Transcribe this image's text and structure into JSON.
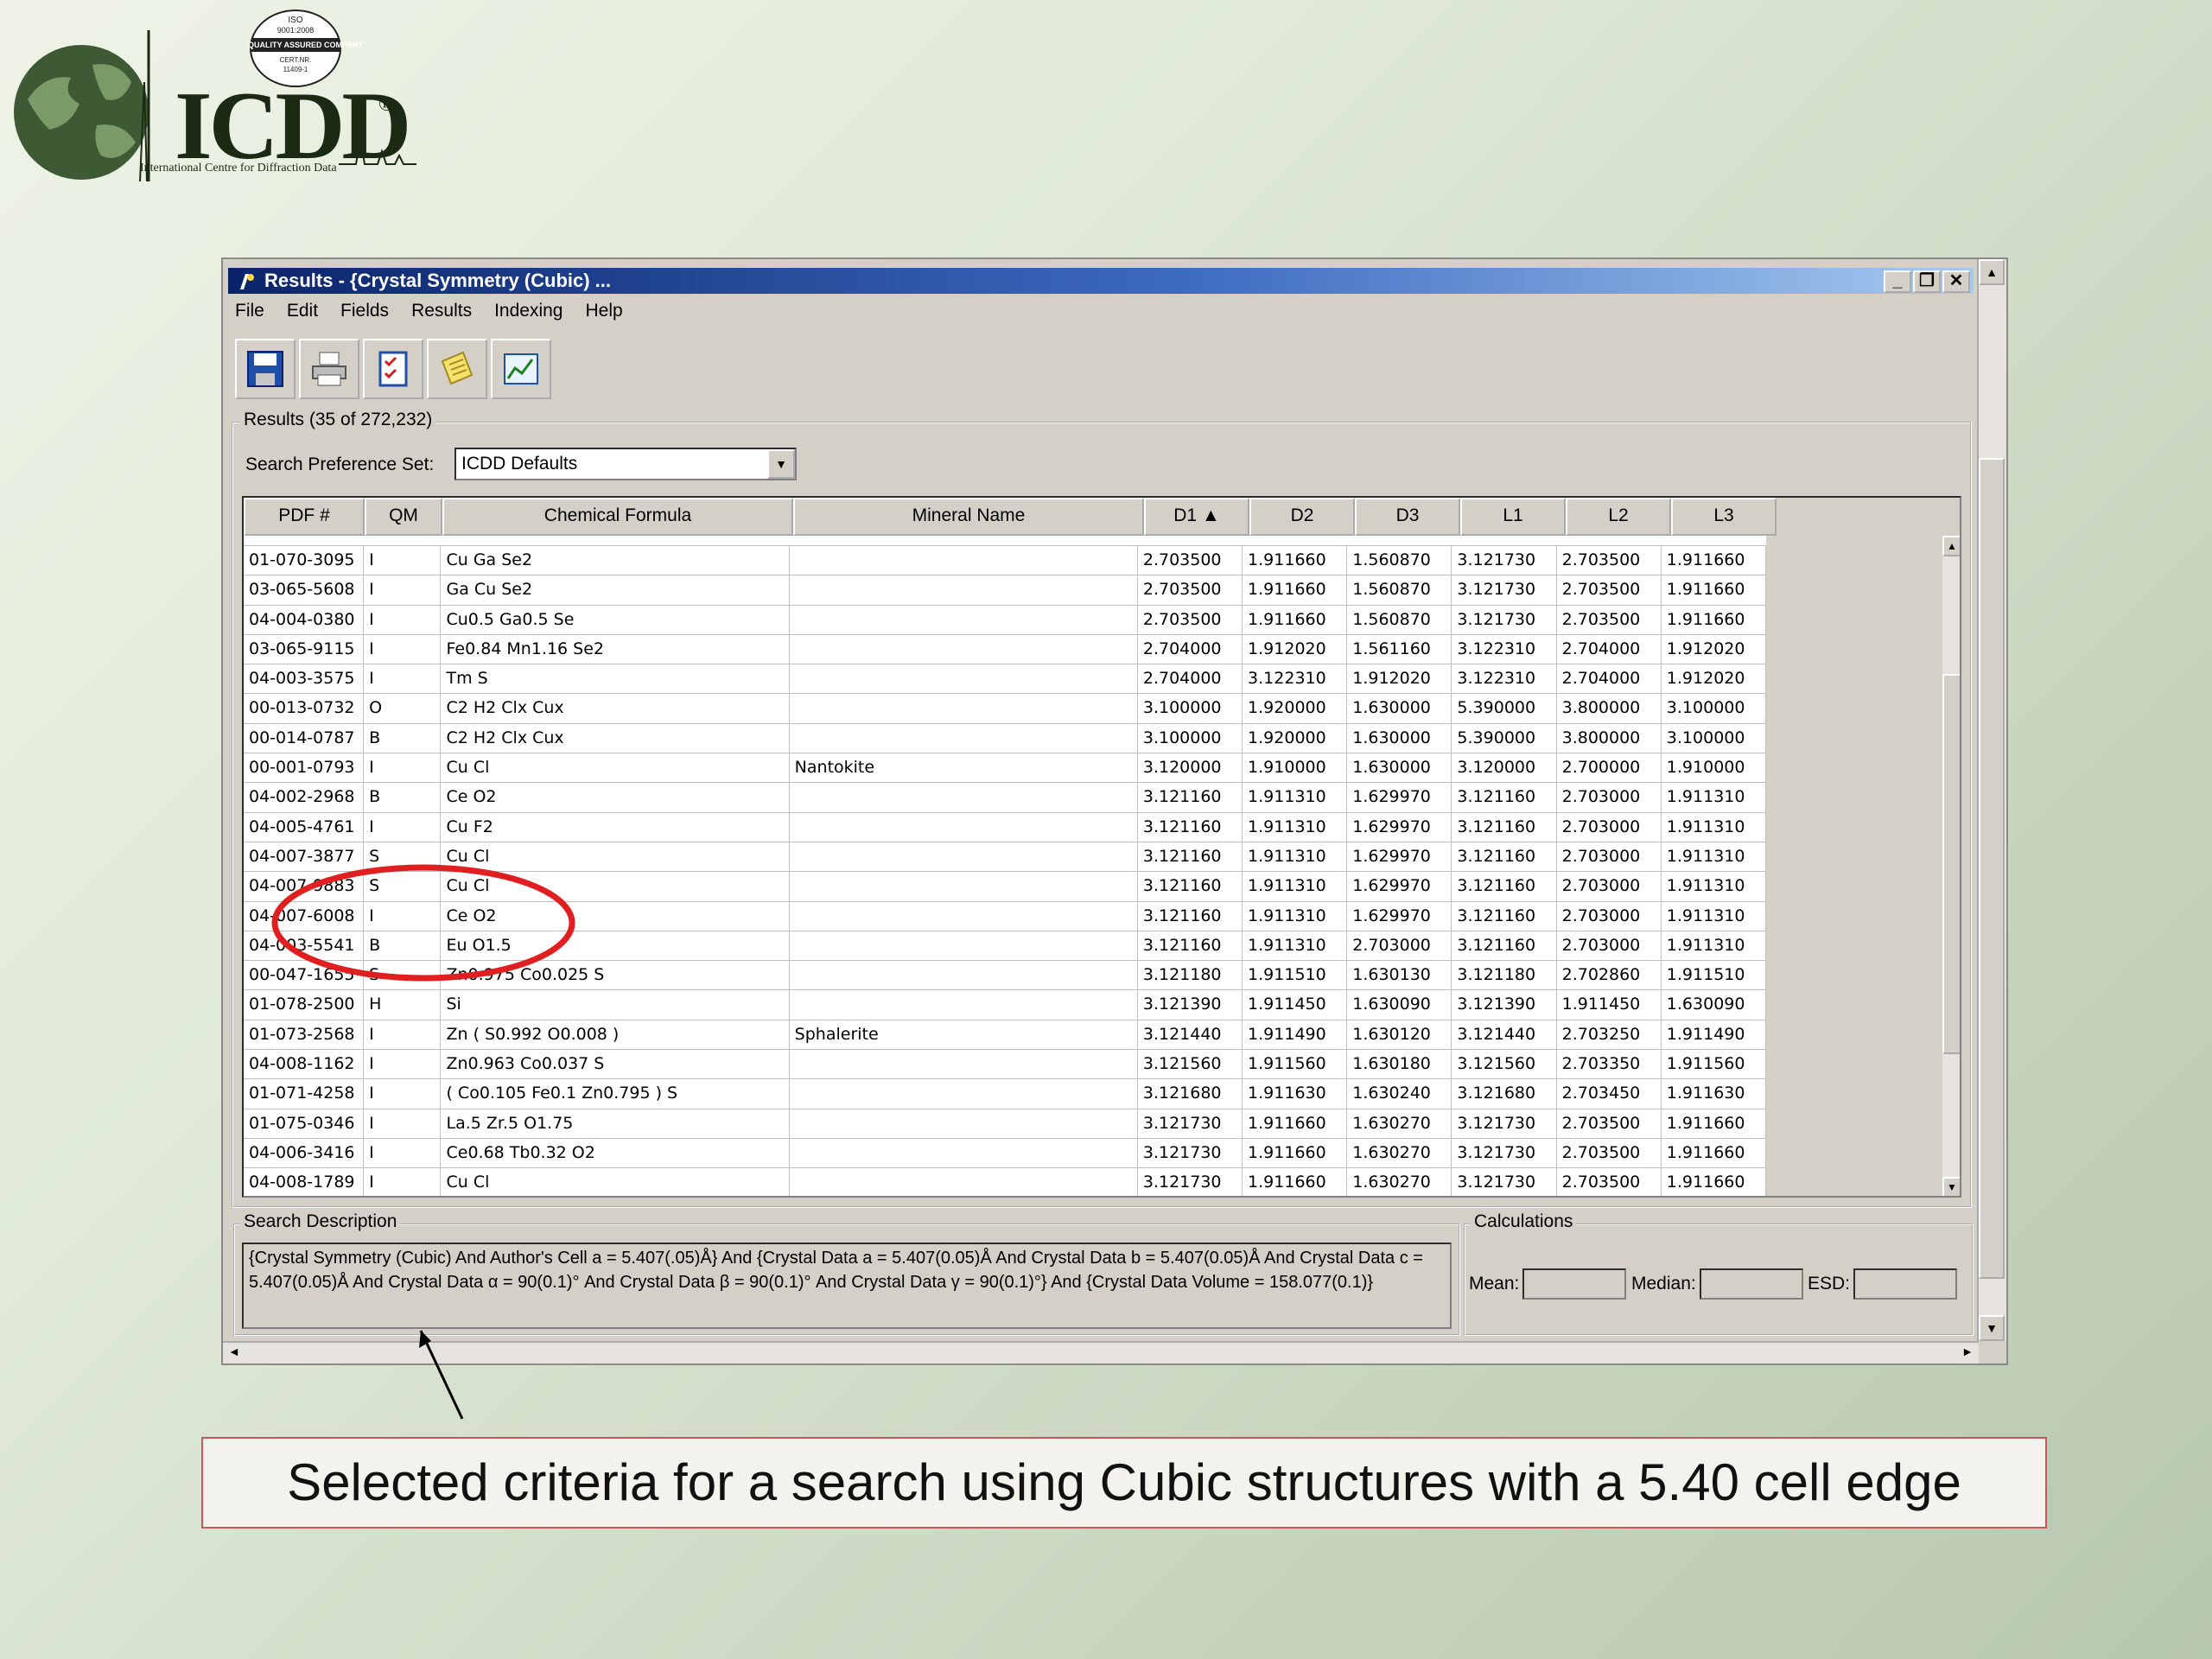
{
  "logo": {
    "text": "ICDD",
    "registered": "®",
    "subtitle": "International Centre for Diffraction Data",
    "iso_badge": [
      "ISO",
      "9001:2008",
      "QUALITY ASSURED COMPANY",
      "CERT.NR.",
      "11409-1"
    ]
  },
  "window": {
    "title": "Results - {Crystal Symmetry (Cubic) ...",
    "controls": [
      "_",
      "❐",
      "✕"
    ]
  },
  "menu": [
    "File",
    "Edit",
    "Fields",
    "Results",
    "Indexing",
    "Help"
  ],
  "toolbar": [
    "save-icon",
    "print-icon",
    "checklist-icon",
    "note-icon",
    "chart-icon"
  ],
  "results_group_label": "Results (35 of 272,232)",
  "search_pref": {
    "label": "Search Preference Set:",
    "value": "ICDD Defaults"
  },
  "table": {
    "columns": [
      "PDF #",
      "QM",
      "Chemical Formula",
      "Mineral Name",
      "D1 ▲",
      "D2",
      "D3",
      "L1",
      "L2",
      "L3"
    ],
    "rows": [
      [
        "01-070-3095",
        "I",
        "Cu Ga Se2",
        "",
        "2.703500",
        "1.911660",
        "1.560870",
        "3.121730",
        "2.703500",
        "1.911660"
      ],
      [
        "03-065-5608",
        "I",
        "Ga Cu Se2",
        "",
        "2.703500",
        "1.911660",
        "1.560870",
        "3.121730",
        "2.703500",
        "1.911660"
      ],
      [
        "04-004-0380",
        "I",
        "Cu0.5 Ga0.5 Se",
        "",
        "2.703500",
        "1.911660",
        "1.560870",
        "3.121730",
        "2.703500",
        "1.911660"
      ],
      [
        "03-065-9115",
        "I",
        "Fe0.84 Mn1.16 Se2",
        "",
        "2.704000",
        "1.912020",
        "1.561160",
        "3.122310",
        "2.704000",
        "1.912020"
      ],
      [
        "04-003-3575",
        "I",
        "Tm S",
        "",
        "2.704000",
        "3.122310",
        "1.912020",
        "3.122310",
        "2.704000",
        "1.912020"
      ],
      [
        "00-013-0732",
        "O",
        "C2 H2 Clx Cux",
        "",
        "3.100000",
        "1.920000",
        "1.630000",
        "5.390000",
        "3.800000",
        "3.100000"
      ],
      [
        "00-014-0787",
        "B",
        "C2 H2 Clx Cux",
        "",
        "3.100000",
        "1.920000",
        "1.630000",
        "5.390000",
        "3.800000",
        "3.100000"
      ],
      [
        "00-001-0793",
        "I",
        "Cu Cl",
        "Nantokite",
        "3.120000",
        "1.910000",
        "1.630000",
        "3.120000",
        "2.700000",
        "1.910000"
      ],
      [
        "04-002-2968",
        "B",
        "Ce O2",
        "",
        "3.121160",
        "1.911310",
        "1.629970",
        "3.121160",
        "2.703000",
        "1.911310"
      ],
      [
        "04-005-4761",
        "I",
        "Cu F2",
        "",
        "3.121160",
        "1.911310",
        "1.629970",
        "3.121160",
        "2.703000",
        "1.911310"
      ],
      [
        "04-007-3877",
        "S",
        "Cu Cl",
        "",
        "3.121160",
        "1.911310",
        "1.629970",
        "3.121160",
        "2.703000",
        "1.911310"
      ],
      [
        "04-007-9883",
        "S",
        "Cu Cl",
        "",
        "3.121160",
        "1.911310",
        "1.629970",
        "3.121160",
        "2.703000",
        "1.911310"
      ],
      [
        "04-007-6008",
        "I",
        "Ce O2",
        "",
        "3.121160",
        "1.911310",
        "1.629970",
        "3.121160",
        "2.703000",
        "1.911310"
      ],
      [
        "04-003-5541",
        "B",
        "Eu O1.5",
        "",
        "3.121160",
        "1.911310",
        "2.703000",
        "3.121160",
        "2.703000",
        "1.911310"
      ],
      [
        "00-047-1655",
        "S",
        "Zn0.975 Co0.025 S",
        "",
        "3.121180",
        "1.911510",
        "1.630130",
        "3.121180",
        "2.702860",
        "1.911510"
      ],
      [
        "01-078-2500",
        "H",
        "Si",
        "",
        "3.121390",
        "1.911450",
        "1.630090",
        "3.121390",
        "1.911450",
        "1.630090"
      ],
      [
        "01-073-2568",
        "I",
        "Zn ( S0.992 O0.008 )",
        "Sphalerite",
        "3.121440",
        "1.911490",
        "1.630120",
        "3.121440",
        "2.703250",
        "1.911490"
      ],
      [
        "04-008-1162",
        "I",
        "Zn0.963 Co0.037 S",
        "",
        "3.121560",
        "1.911560",
        "1.630180",
        "3.121560",
        "2.703350",
        "1.911560"
      ],
      [
        "01-071-4258",
        "I",
        "( Co0.105 Fe0.1 Zn0.795 ) S",
        "",
        "3.121680",
        "1.911630",
        "1.630240",
        "3.121680",
        "2.703450",
        "1.911630"
      ],
      [
        "01-075-0346",
        "I",
        "La.5 Zr.5 O1.75",
        "",
        "3.121730",
        "1.911660",
        "1.630270",
        "3.121730",
        "2.703500",
        "1.911660"
      ],
      [
        "04-006-3416",
        "I",
        "Ce0.68 Tb0.32 O2",
        "",
        "3.121730",
        "1.911660",
        "1.630270",
        "3.121730",
        "2.703500",
        "1.911660"
      ],
      [
        "04-008-1789",
        "I",
        "Cu Cl",
        "",
        "3.121730",
        "1.911660",
        "1.630270",
        "3.121730",
        "2.703500",
        "1.911660"
      ]
    ]
  },
  "search_description": {
    "label": "Search Description",
    "text": "{Crystal Symmetry (Cubic) And Author's Cell a = 5.407(.05)Å} And {Crystal Data a = 5.407(0.05)Å And Crystal Data b = 5.407(0.05)Å And Crystal Data c = 5.407(0.05)Å And Crystal Data α = 90(0.1)° And Crystal Data β = 90(0.1)° And Crystal Data γ = 90(0.1)°} And {Crystal Data Volume = 158.077(0.1)}"
  },
  "calculations": {
    "label": "Calculations",
    "mean_label": "Mean:",
    "median_label": "Median:",
    "esd_label": "ESD:"
  },
  "caption": "Selected criteria for a search using Cubic structures with a 5.40 cell edge",
  "colors": {
    "annotation_red": "#e02020",
    "title_blue": "#0a246a",
    "caption_border": "#c8555a"
  }
}
